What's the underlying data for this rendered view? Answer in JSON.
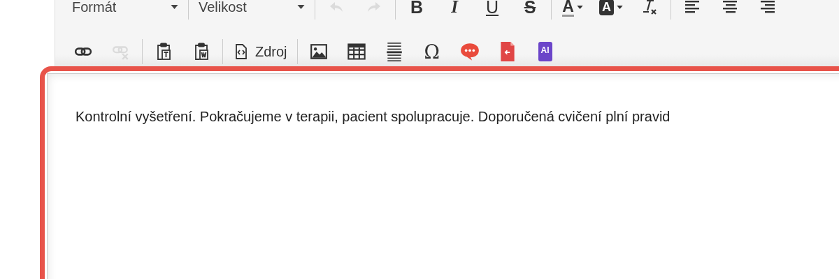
{
  "toolbar": {
    "rows": [
      {
        "groups": [
          {
            "items": [
              {
                "kind": "dropdown",
                "label": "Formát"
              }
            ]
          },
          {
            "items": [
              {
                "kind": "dropdown",
                "label": "Velikost"
              }
            ]
          },
          {
            "items": [
              {
                "kind": "undo",
                "disabled": true
              },
              {
                "kind": "redo",
                "disabled": true
              }
            ]
          },
          {
            "items": [
              {
                "kind": "bold",
                "glyph": "B",
                "disabled": false
              },
              {
                "kind": "italic",
                "glyph": "I",
                "disabled": false
              },
              {
                "kind": "underline",
                "glyph": "U",
                "disabled": false
              },
              {
                "kind": "strike",
                "glyph": "S",
                "disabled": false
              }
            ]
          },
          {
            "items": [
              {
                "kind": "textcolor",
                "glyph": "A",
                "disabled": false
              },
              {
                "kind": "bgcolor",
                "glyph": "A",
                "disabled": false
              },
              {
                "kind": "removeformat",
                "disabled": false
              }
            ]
          },
          {
            "items": [
              {
                "kind": "alignleft",
                "disabled": false
              },
              {
                "kind": "aligncenter",
                "disabled": false
              },
              {
                "kind": "alignright",
                "disabled": false
              }
            ]
          }
        ]
      },
      {
        "groups": [
          {
            "items": [
              {
                "kind": "link",
                "disabled": false
              },
              {
                "kind": "unlink",
                "disabled": true
              }
            ]
          },
          {
            "items": [
              {
                "kind": "pastetext",
                "disabled": false
              },
              {
                "kind": "pasteword",
                "disabled": false
              }
            ]
          },
          {
            "items": [
              {
                "kind": "source",
                "label": "Zdroj",
                "disabled": false
              }
            ]
          },
          {
            "items": [
              {
                "kind": "image",
                "disabled": false
              },
              {
                "kind": "table",
                "disabled": false
              },
              {
                "kind": "pagebreak",
                "disabled": false
              },
              {
                "kind": "specialchar",
                "glyph": "Ω",
                "disabled": false
              },
              {
                "kind": "comment",
                "disabled": false
              },
              {
                "kind": "import",
                "disabled": false
              },
              {
                "kind": "ai",
                "glyph": "AI",
                "disabled": false
              }
            ]
          }
        ]
      }
    ]
  },
  "editor": {
    "text": "Kontrolní vyšetření. Pokračujeme v terapii, pacient spolupracuje. Doporučená cvičení plní pravid"
  }
}
